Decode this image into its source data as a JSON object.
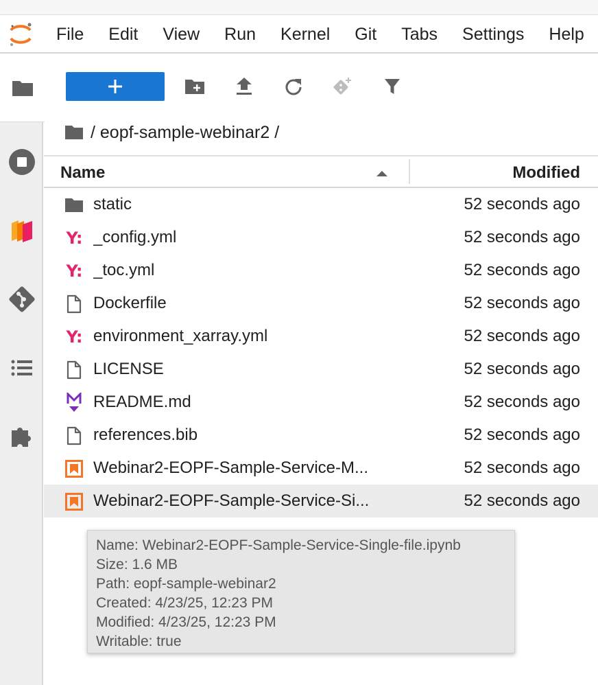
{
  "menubar": {
    "items": [
      "File",
      "Edit",
      "View",
      "Run",
      "Kernel",
      "Git",
      "Tabs",
      "Settings",
      "Help"
    ]
  },
  "sidebar": {
    "tabs": [
      {
        "icon": "folder-icon",
        "active": true
      },
      {
        "icon": "stop-circle-icon",
        "active": false
      },
      {
        "icon": "extension-stack-icon",
        "active": false
      },
      {
        "icon": "git-icon",
        "active": false
      },
      {
        "icon": "toc-list-icon",
        "active": false
      },
      {
        "icon": "puzzle-icon",
        "active": false
      }
    ]
  },
  "toolbar": {
    "new_label": "+",
    "icons": [
      "new-folder-icon",
      "upload-icon",
      "refresh-icon",
      "git-clone-icon",
      "filter-icon"
    ]
  },
  "breadcrumb": {
    "path": "/ eopf-sample-webinar2 /"
  },
  "listing": {
    "columns": {
      "name": "Name",
      "modified": "Modified"
    },
    "rows": [
      {
        "icon": "folder",
        "name": "static",
        "modified": "52 seconds ago"
      },
      {
        "icon": "yaml",
        "name": "_config.yml",
        "modified": "52 seconds ago"
      },
      {
        "icon": "yaml",
        "name": "_toc.yml",
        "modified": "52 seconds ago"
      },
      {
        "icon": "file",
        "name": "Dockerfile",
        "modified": "52 seconds ago"
      },
      {
        "icon": "yaml",
        "name": "environment_xarray.yml",
        "modified": "52 seconds ago"
      },
      {
        "icon": "file",
        "name": "LICENSE",
        "modified": "52 seconds ago"
      },
      {
        "icon": "markdown",
        "name": "README.md",
        "modified": "52 seconds ago"
      },
      {
        "icon": "file",
        "name": "references.bib",
        "modified": "52 seconds ago"
      },
      {
        "icon": "notebook",
        "name": "Webinar2-EOPF-Sample-Service-M...",
        "modified": "52 seconds ago"
      },
      {
        "icon": "notebook",
        "name": "Webinar2-EOPF-Sample-Service-Si...",
        "modified": "52 seconds ago",
        "selected": true
      }
    ]
  },
  "tooltip": {
    "name": "Name: Webinar2-EOPF-Sample-Service-Single-file.ipynb",
    "size": "Size: 1.6 MB",
    "path": "Path: eopf-sample-webinar2",
    "created": "Created: 4/23/25, 12:23 PM",
    "modified": "Modified: 4/23/25, 12:23 PM",
    "writable": "Writable: true"
  },
  "colors": {
    "accent": "#1976d2",
    "yaml": "#e3266a",
    "notebook": "#f37726",
    "markdown": "#7b2fb7",
    "icon_gray": "#616161"
  }
}
